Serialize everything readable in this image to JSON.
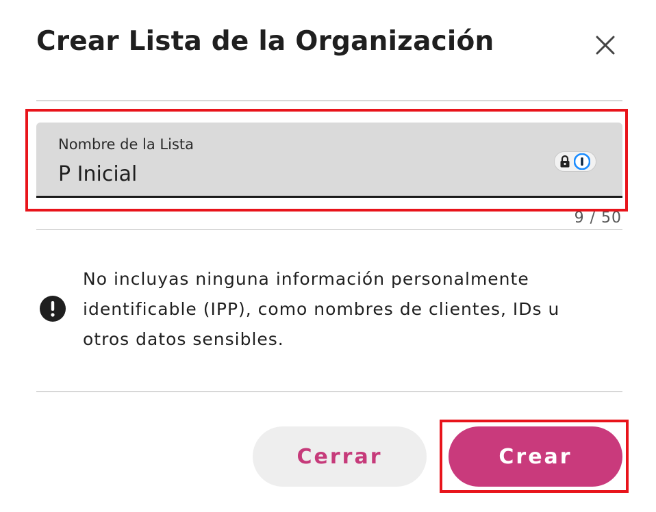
{
  "dialog": {
    "title": "Crear Lista de la Organización",
    "close_icon": "close-icon"
  },
  "field": {
    "label": "Nombre de la Lista",
    "value": "P Inicial",
    "counter": "9 / 50",
    "password_manager_icon": "lock-and-1password-icon"
  },
  "alert": {
    "icon": "exclamation-circle-icon",
    "text": "No incluyas ninguna información personalmente identificable (IPP), como nombres de clientes, IDs u otros datos sensibles."
  },
  "actions": {
    "close_label": "Cerrar",
    "create_label": "Crear"
  },
  "colors": {
    "accent": "#c93a7c",
    "highlight": "#e8141b",
    "field_background": "#dadada"
  }
}
